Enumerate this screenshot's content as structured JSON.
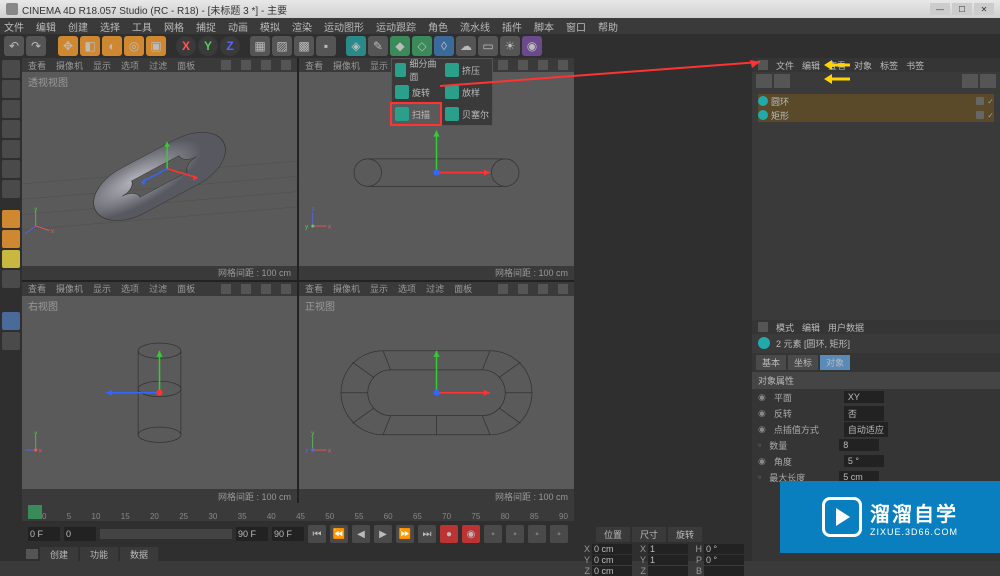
{
  "title": "CINEMA 4D R18.057 Studio (RC - R18) - [未标题 3 *] - 主要",
  "menus": [
    "文件",
    "编辑",
    "创建",
    "选择",
    "工具",
    "网格",
    "捕捉",
    "动画",
    "模拟",
    "渲染",
    "运动图形",
    "运动跟踪",
    "角色",
    "流水线",
    "插件",
    "脚本",
    "窗口",
    "帮助"
  ],
  "axes": {
    "x": "X",
    "y": "Y",
    "z": "Z"
  },
  "popup": {
    "rows": [
      [
        {
          "icon": "#2aa08a",
          "label": "细分曲面"
        },
        {
          "icon": "#2aa08a",
          "label": "挤压"
        }
      ],
      [
        {
          "icon": "#2aa08a",
          "label": "旋转"
        },
        {
          "icon": "#2aa08a",
          "label": "放样"
        }
      ],
      [
        {
          "icon": "#2aa08a",
          "label": "扫描"
        },
        {
          "icon": "#2aa08a",
          "label": "贝塞尔"
        }
      ]
    ],
    "highlighted_index": 2
  },
  "viewport_menu": [
    "查看",
    "摄像机",
    "显示",
    "选项",
    "过滤",
    "面板"
  ],
  "viewports": {
    "tl": {
      "label": "透视视图",
      "status": "网格间距 : 100 cm"
    },
    "tr": {
      "label": "",
      "status": "网格间距 : 100 cm"
    },
    "bl": {
      "label": "右视图",
      "status": "网格间距 : 100 cm"
    },
    "br": {
      "label": "正视图",
      "status": "网格间距 : 100 cm"
    }
  },
  "timeline": {
    "start": "0 F",
    "current": "0",
    "end": "90 F",
    "end2": "90 F",
    "ticks": [
      "0",
      "5",
      "10",
      "15",
      "20",
      "25",
      "30",
      "35",
      "40",
      "45",
      "50",
      "55",
      "60",
      "65",
      "70",
      "75",
      "80",
      "85",
      "90"
    ]
  },
  "bottom_tabs": [
    "创建",
    "功能",
    "数据"
  ],
  "objects_panel": {
    "tabs": [
      "文件",
      "编辑",
      "查看",
      "对象",
      "标签",
      "书签"
    ],
    "rows": [
      {
        "icon": "teal",
        "name": "圆环"
      },
      {
        "icon": "teal",
        "name": "矩形"
      }
    ]
  },
  "attributes": {
    "mode_tabs": [
      "模式",
      "编辑",
      "用户数据"
    ],
    "title": "2 元素 [圆环, 矩形]",
    "tab_row": [
      "基本",
      "坐标",
      "对象"
    ],
    "active_tab": "对象",
    "group": "对象属性",
    "rows": [
      {
        "label": "平面",
        "value": "XY"
      },
      {
        "label": "反转",
        "value": "否"
      }
    ],
    "group2": "点插值方式",
    "group2_value": "自动适应",
    "rows2": [
      {
        "label": "数量",
        "value": "8"
      },
      {
        "label": "角度",
        "value": "5 °"
      },
      {
        "label": "最大长度",
        "value": "5 cm"
      }
    ]
  },
  "coords": {
    "headers": [
      "位置",
      "尺寸",
      "旋转"
    ],
    "x": {
      "pos": "0 cm",
      "size": "1",
      "rot": "0 °"
    },
    "y": {
      "pos": "0 cm",
      "size": "1",
      "rot": "0 °"
    },
    "z": {
      "pos": "0 cm",
      "size": "",
      "rot": ""
    },
    "labels": {
      "x": "X",
      "y": "Y",
      "z": "Z",
      "h": "H",
      "p": "P",
      "b": "B"
    }
  },
  "watermark": {
    "title": "溜溜自学",
    "url": "ZIXUE.3D66.COM"
  }
}
